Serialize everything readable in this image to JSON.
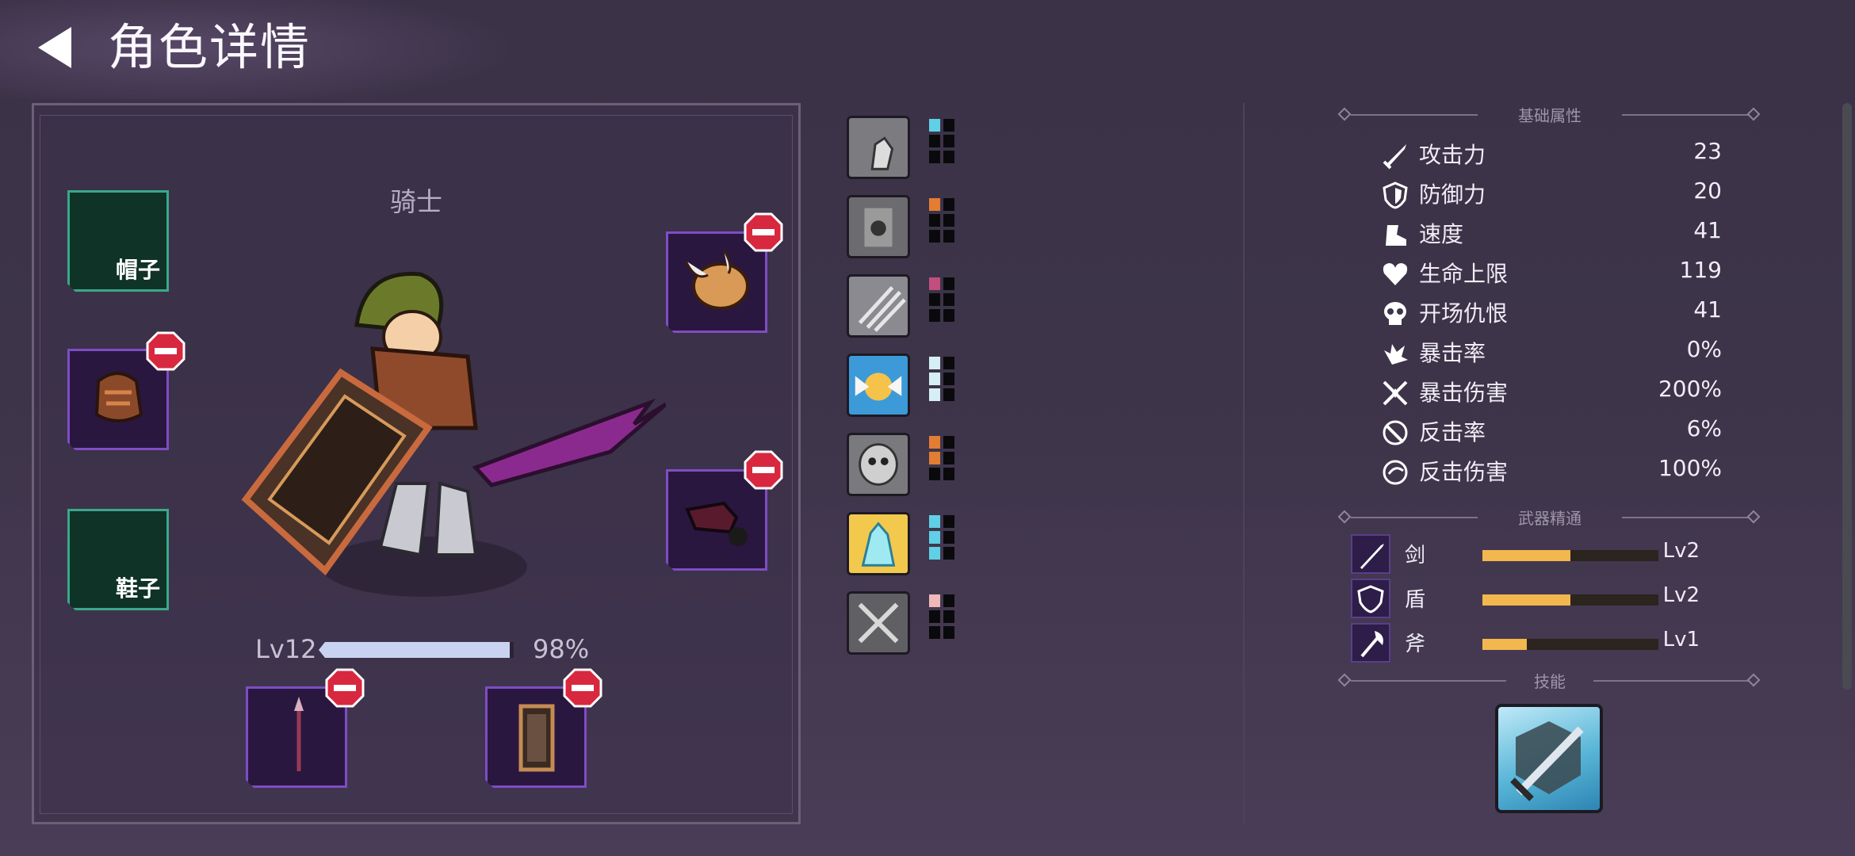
{
  "header": {
    "title": "角色详情"
  },
  "character": {
    "class_name": "骑士",
    "level_label": "Lv12",
    "xp_percent_text": "98%",
    "xp_fraction": 0.98
  },
  "equipment": {
    "hat_label": "帽子",
    "shoes_label": "鞋子"
  },
  "skill_column": [
    {
      "pips": [
        "#5fd0e6",
        "#0a0a0d",
        "#0a0a0d",
        "#0a0a0d",
        "#0a0a0d",
        "#0a0a0d"
      ]
    },
    {
      "pips": [
        "#e27d33",
        "#0a0a0d",
        "#0a0a0d",
        "#0a0a0d",
        "#0a0a0d",
        "#0a0a0d"
      ]
    },
    {
      "pips": [
        "#c24e7e",
        "#0a0a0d",
        "#0a0a0d",
        "#0a0a0d",
        "#0a0a0d",
        "#0a0a0d"
      ]
    },
    {
      "pips": [
        "#d6eef6",
        "#0a0a0d",
        "#d6eef6",
        "#0a0a0d",
        "#d6eef6",
        "#0a0a0d"
      ]
    },
    {
      "pips": [
        "#e27d33",
        "#0a0a0d",
        "#e27d33",
        "#0a0a0d",
        "#0a0a0d",
        "#0a0a0d"
      ]
    },
    {
      "pips": [
        "#5fd0e6",
        "#0a0a0d",
        "#5fd0e6",
        "#0a0a0d",
        "#5fd0e6",
        "#0a0a0d"
      ]
    },
    {
      "pips": [
        "#f0b8b8",
        "#0a0a0d",
        "#0a0a0d",
        "#0a0a0d",
        "#0a0a0d",
        "#0a0a0d"
      ]
    }
  ],
  "basic_stats": {
    "header": "基础属性",
    "rows": [
      {
        "name": "攻击力",
        "value": "23",
        "icon": "sword-icon"
      },
      {
        "name": "防御力",
        "value": "20",
        "icon": "shield-icon"
      },
      {
        "name": "速度",
        "value": "41",
        "icon": "boot-icon"
      },
      {
        "name": "生命上限",
        "value": "119",
        "icon": "heart-icon"
      },
      {
        "name": "开场仇恨",
        "value": "41",
        "icon": "skull-icon"
      },
      {
        "name": "暴击率",
        "value": "0%",
        "icon": "crit-rate-icon"
      },
      {
        "name": "暴击伤害",
        "value": "200%",
        "icon": "crit-damage-icon"
      },
      {
        "name": "反击率",
        "value": "6%",
        "icon": "counter-rate-icon"
      },
      {
        "name": "反击伤害",
        "value": "100%",
        "icon": "counter-damage-icon"
      }
    ]
  },
  "weapon_mastery": {
    "header": "武器精通",
    "rows": [
      {
        "name": "剑",
        "level": "Lv2",
        "progress": 0.5,
        "icon": "sword-mastery-icon"
      },
      {
        "name": "盾",
        "level": "Lv2",
        "progress": 0.5,
        "icon": "shield-mastery-icon"
      },
      {
        "name": "斧",
        "level": "Lv1",
        "progress": 0.25,
        "icon": "axe-mastery-icon"
      }
    ]
  },
  "skills": {
    "header": "技能"
  },
  "colors": {
    "accent_purple": "#7e4dc4",
    "empty_slot_green": "#3aa88a",
    "mastery_bar": "#f3b74f",
    "remove_red": "#d8283f"
  }
}
